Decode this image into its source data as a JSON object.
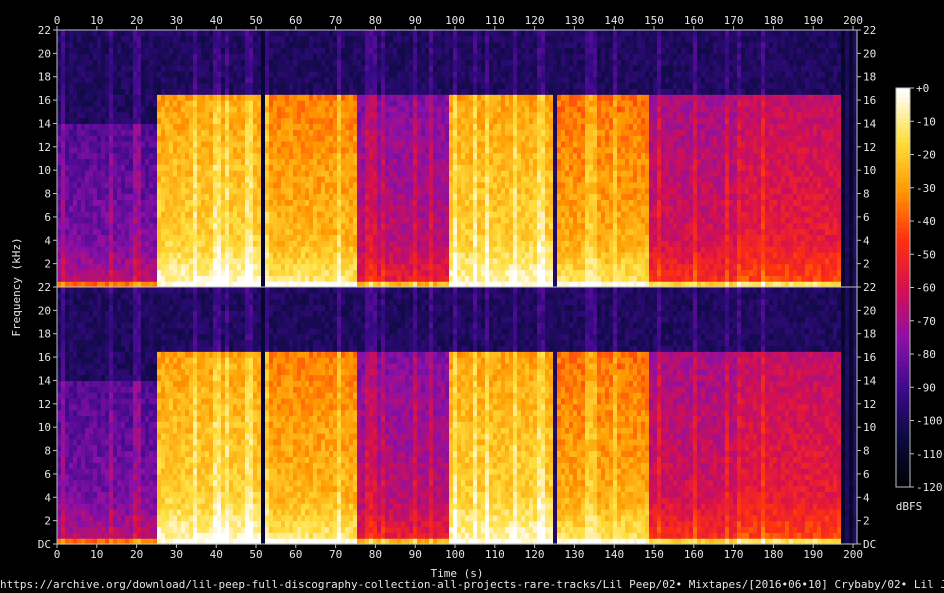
{
  "chart_data": {
    "type": "heatmap",
    "x": {
      "label": "Time (s)",
      "range": [
        0,
        201
      ],
      "ticks": [
        0,
        10,
        20,
        30,
        40,
        50,
        60,
        70,
        80,
        90,
        100,
        110,
        120,
        130,
        140,
        150,
        160,
        170,
        180,
        190,
        200
      ]
    },
    "y": {
      "label": "Frequency (kHz)",
      "range": [
        0,
        22
      ],
      "ticks": [
        {
          "value": 0,
          "label": "DC"
        },
        {
          "value": 2,
          "label": "2"
        },
        {
          "value": 4,
          "label": "4"
        },
        {
          "value": 6,
          "label": "6"
        },
        {
          "value": 8,
          "label": "8"
        },
        {
          "value": 10,
          "label": "10"
        },
        {
          "value": 12,
          "label": "12"
        },
        {
          "value": 14,
          "label": "14"
        },
        {
          "value": 16,
          "label": "16"
        },
        {
          "value": 18,
          "label": "18"
        },
        {
          "value": 20,
          "label": "20"
        },
        {
          "value": 22,
          "label": "22"
        }
      ]
    },
    "channels": 2,
    "colorbar": {
      "label": "dBFS",
      "range": [
        -120,
        0
      ],
      "ticks": [
        {
          "value": 0,
          "label": "+0"
        },
        {
          "value": -10,
          "label": "-10"
        },
        {
          "value": -20,
          "label": "-20"
        },
        {
          "value": -30,
          "label": "-30"
        },
        {
          "value": -40,
          "label": "-40"
        },
        {
          "value": -50,
          "label": "-50"
        },
        {
          "value": -60,
          "label": "-60"
        },
        {
          "value": -70,
          "label": "-70"
        },
        {
          "value": -80,
          "label": "-80"
        },
        {
          "value": -90,
          "label": "-90"
        },
        {
          "value": -100,
          "label": "-100"
        },
        {
          "value": -110,
          "label": "-110"
        },
        {
          "value": -120,
          "label": "-120"
        }
      ]
    },
    "segments": [
      {
        "start": 0,
        "end": 25,
        "cutoff_khz": 14,
        "level": 0.35
      },
      {
        "start": 25,
        "end": 51.5,
        "cutoff_khz": 16.5,
        "level": 0.85
      },
      {
        "start": 52.5,
        "end": 75,
        "cutoff_khz": 16.5,
        "level": 0.8
      },
      {
        "start": 75,
        "end": 98,
        "cutoff_khz": 16.5,
        "level": 0.45
      },
      {
        "start": 98,
        "end": 125,
        "cutoff_khz": 16.5,
        "level": 0.85
      },
      {
        "start": 126,
        "end": 149,
        "cutoff_khz": 16.5,
        "level": 0.78
      },
      {
        "start": 149,
        "end": 172,
        "cutoff_khz": 16.5,
        "level": 0.5
      },
      {
        "start": 172,
        "end": 197,
        "cutoff_khz": 16.5,
        "level": 0.55
      }
    ],
    "colors": [
      "#000000",
      "#0a0a3c",
      "#3a0a8a",
      "#8a10a8",
      "#d41050",
      "#ff3010",
      "#ff9a00",
      "#ffe040",
      "#ffffff"
    ]
  },
  "source": "https://archive.org/download/lil-peep-full-discography-collection-all-projects-rare-tracks/Lil Peep/02• Mixtapes/[2016•06•10] Crybaby/02• Lil Jeep.mp3"
}
